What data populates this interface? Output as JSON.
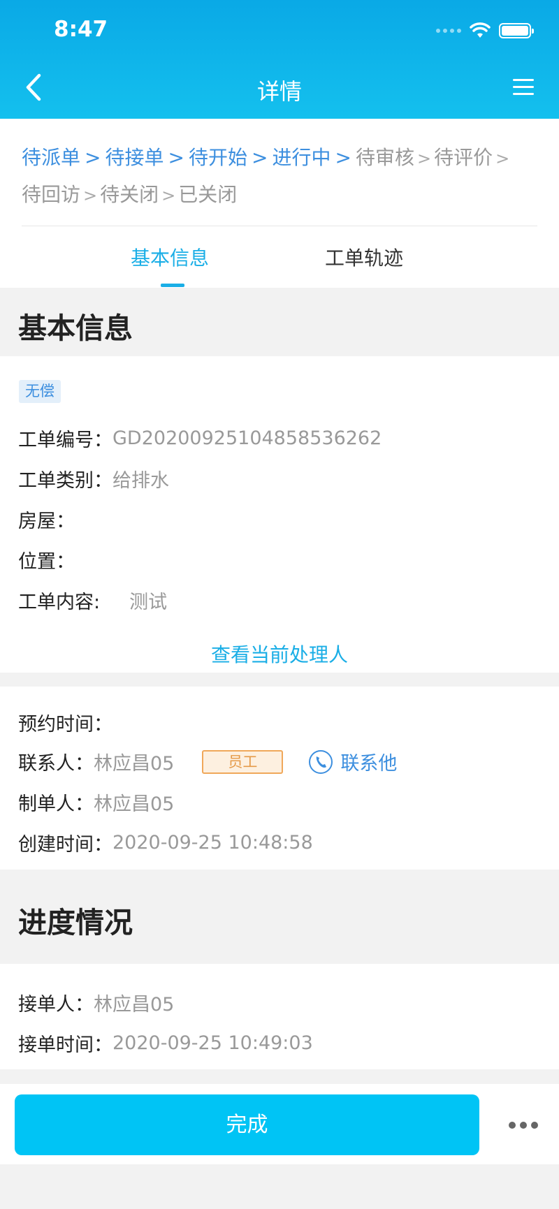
{
  "status_bar": {
    "time": "8:47"
  },
  "nav": {
    "title": "详情"
  },
  "workflow_steps": [
    {
      "label": "待派单",
      "done": true
    },
    {
      "label": "待接单",
      "done": true
    },
    {
      "label": "待开始",
      "done": true
    },
    {
      "label": "进行中",
      "done": true
    },
    {
      "label": "待审核",
      "done": false
    },
    {
      "label": "待评价",
      "done": false
    },
    {
      "label": "待回访",
      "done": false
    },
    {
      "label": "待关闭",
      "done": false
    },
    {
      "label": "已关闭",
      "done": false
    }
  ],
  "separator": ">",
  "tabs": {
    "basic": "基本信息",
    "track": "工单轨迹"
  },
  "basic_section": {
    "title": "基本信息",
    "badge": "无偿",
    "order_no_label": "工单编号：",
    "order_no": "GD20200925104858536262",
    "category_label": "工单类别：",
    "category": "给排水",
    "house_label": "房屋：",
    "position_label": "位置：",
    "content_label": "工单内容:",
    "content": "测试",
    "view_handler": "查看当前处理人"
  },
  "contact_section": {
    "appointment_label": "预约时间：",
    "contact_label": "联系人：",
    "contact_name": "林应昌05",
    "staff_tag": "员工",
    "call_label": "联系他",
    "creator_label": "制单人：",
    "creator": "林应昌05",
    "created_label": "创建时间：",
    "created_time": "2020-09-25 10:48:58"
  },
  "progress_section": {
    "title": "进度情况",
    "receiver_label": "接单人：",
    "receiver": "林应昌05",
    "receive_time_label": "接单时间：",
    "receive_time": "2020-09-25 10:49:03"
  },
  "actions": {
    "done_label": "完成"
  },
  "colors": {
    "header": "#0aa9e6",
    "accent": "#1aaee6",
    "link": "#3d8fdf",
    "primary_button": "#00c4f5",
    "staff_tag": "#e59a48"
  }
}
